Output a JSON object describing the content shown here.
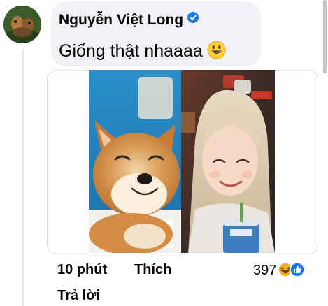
{
  "comment": {
    "author": "Nguyễn Việt Long",
    "verified": true,
    "text": "Giống thật nhaaaa",
    "emoji_icon": "grinning-face-icon"
  },
  "attachment": {
    "left_image": "smiling-shiba-dog-photo",
    "right_image": "smiling-girl-photo"
  },
  "actions": {
    "time": "10 phút",
    "like": "Thích",
    "reply": "Trả lời"
  },
  "reactions": {
    "count": "397",
    "icons": [
      "haha-icon",
      "like-icon"
    ]
  },
  "colors": {
    "bubble": "#f0f2f5",
    "verified_blue": "#1877f2",
    "text": "#050505"
  }
}
